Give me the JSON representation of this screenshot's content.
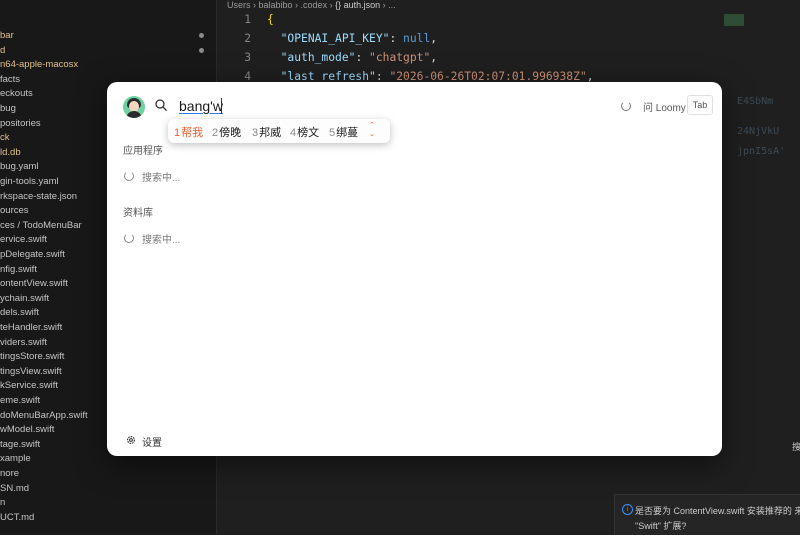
{
  "sidebar": {
    "items": [
      {
        "label": "bar",
        "modified": true
      },
      {
        "label": "d",
        "modified": true
      },
      {
        "label": "n64-apple-macosx",
        "modified": true
      },
      {
        "label": "facts",
        "modified": false
      },
      {
        "label": "eckouts",
        "modified": false
      },
      {
        "label": "bug",
        "modified": false
      },
      {
        "label": "positories",
        "modified": false
      },
      {
        "label": "ck",
        "modified": true
      },
      {
        "label": "ld.db",
        "modified": true
      },
      {
        "label": "bug.yaml",
        "modified": false
      },
      {
        "label": "gin-tools.yaml",
        "modified": false
      },
      {
        "label": "rkspace-state.json",
        "modified": false
      },
      {
        "label": "ources",
        "modified": false
      },
      {
        "label": "ces / TodoMenuBar",
        "modified": false
      },
      {
        "label": "ervice.swift",
        "modified": false
      },
      {
        "label": "pDelegate.swift",
        "modified": false
      },
      {
        "label": "nfig.swift",
        "modified": false
      },
      {
        "label": "ontentView.swift",
        "modified": false
      },
      {
        "label": "ychain.swift",
        "modified": false
      },
      {
        "label": "dels.swift",
        "modified": false
      },
      {
        "label": "teHandler.swift",
        "modified": false
      },
      {
        "label": "viders.swift",
        "modified": false
      },
      {
        "label": "tingsStore.swift",
        "modified": false
      },
      {
        "label": "tingsView.swift",
        "modified": false
      },
      {
        "label": "kService.swift",
        "modified": false
      },
      {
        "label": "eme.swift",
        "modified": false
      },
      {
        "label": "doMenuBarApp.swift",
        "modified": false
      },
      {
        "label": "wModel.swift",
        "modified": false
      },
      {
        "label": "tage.swift",
        "modified": false
      },
      {
        "label": "xample",
        "modified": false
      },
      {
        "label": "nore",
        "modified": false
      },
      {
        "label": "SN.md",
        "modified": false
      },
      {
        "label": "n",
        "modified": false
      },
      {
        "label": "UCT.md",
        "modified": false
      }
    ]
  },
  "editor": {
    "breadcrumb": [
      "Users",
      "balabibo",
      ".codex",
      "{} auth.json",
      "..."
    ],
    "lines": [
      {
        "num": "1",
        "tokens": [
          {
            "t": "{",
            "c": "b"
          }
        ]
      },
      {
        "num": "2",
        "tokens": [
          {
            "t": "  ",
            "c": "p"
          },
          {
            "t": "\"OPENAI_API_KEY\"",
            "c": "k"
          },
          {
            "t": ": ",
            "c": "p"
          },
          {
            "t": "null",
            "c": "n"
          },
          {
            "t": ",",
            "c": "p"
          }
        ]
      },
      {
        "num": "3",
        "tokens": [
          {
            "t": "  ",
            "c": "p"
          },
          {
            "t": "\"auth_mode\"",
            "c": "k"
          },
          {
            "t": ": ",
            "c": "p"
          },
          {
            "t": "\"chatgpt\"",
            "c": "s"
          },
          {
            "t": ",",
            "c": "p"
          }
        ]
      },
      {
        "num": "4",
        "tokens": [
          {
            "t": "  ",
            "c": "p"
          },
          {
            "t": "\"last_refresh\"",
            "c": "k"
          },
          {
            "t": ": ",
            "c": "p"
          },
          {
            "t": "\"2026-06-26T02:07:01.996938Z\"",
            "c": "s"
          },
          {
            "t": ",",
            "c": "p"
          }
        ]
      }
    ]
  },
  "notification": {
    "line1": "是否要为 ContentView.swift 安装推荐的 来",
    "line2": "\"Swift\" 扩展?"
  },
  "launcher": {
    "query": "bang'w",
    "ime_candidates": [
      {
        "num": "1",
        "text": "帮我",
        "selected": true
      },
      {
        "num": "2",
        "text": "傍晚",
        "selected": false
      },
      {
        "num": "3",
        "text": "邦威",
        "selected": false
      },
      {
        "num": "4",
        "text": "榜文",
        "selected": false
      },
      {
        "num": "5",
        "text": "绑蔓",
        "selected": false
      }
    ],
    "provider": "问 Loomy",
    "tab_key": "Tab",
    "sections": [
      {
        "title": "应用程序",
        "status": "搜索中..."
      },
      {
        "title": "资料库",
        "status": "搜索中..."
      }
    ],
    "settings_label": "设置"
  },
  "colors": {
    "accent": "#e8612c",
    "underline": "#3478f6",
    "info": "#3794ff"
  }
}
